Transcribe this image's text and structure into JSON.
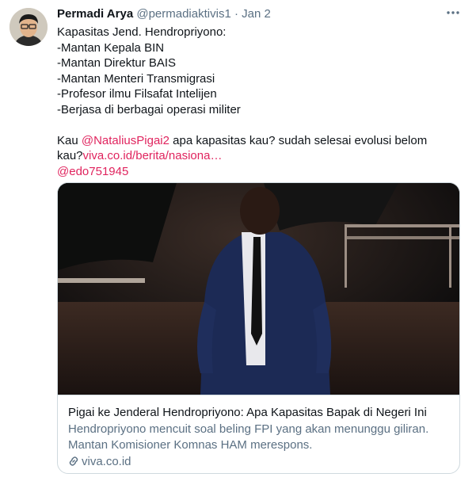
{
  "author": {
    "name": "Permadi Arya",
    "handle": "@permadiaktivis1",
    "separator": "·",
    "date": "Jan 2"
  },
  "menu_icon": "more-icon",
  "tweet": {
    "lines": [
      "Kapasitas Jend. Hendropriyono:",
      "-Mantan Kepala BIN",
      "-Mantan Direktur BAIS",
      "-Mantan Menteri Transmigrasi",
      "-Profesor ilmu Filsafat Intelijen",
      "-Berjasa di berbagai operasi militer"
    ],
    "reply_prefix": "Kau ",
    "mention_1": "@NataliusPigai2",
    "reply_text": " apa kapasitas kau? sudah selesai evolusi belom",
    "reply_text_2": "kau?",
    "url_text": "viva.co.id/berita/nasiona…",
    "mention_2": "@edo751945"
  },
  "card": {
    "title": "Pigai ke Jenderal Hendropriyono: Apa Kapasitas Bapak di Negeri Ini",
    "description": "Hendropriyono mencuit soal beling FPI yang akan menunggu giliran. Mantan Komisioner Komnas HAM merespons.",
    "domain": "viva.co.id",
    "domain_icon": "link-icon"
  },
  "colors": {
    "link": "#e0245e",
    "secondary_text": "#5b7083",
    "border": "#cfd9de"
  }
}
